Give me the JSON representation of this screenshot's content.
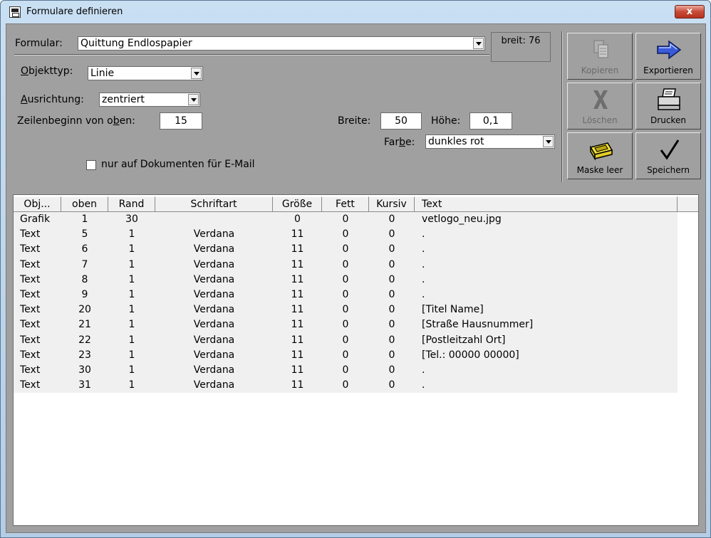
{
  "window": {
    "title": "Formulare definieren",
    "close_label": "x"
  },
  "form": {
    "formular_label": "Formular:",
    "formular_value": "Quittung Endlospapier",
    "breit_label": "breit: 76",
    "objekttyp_label": "Objekttyp:",
    "objekttyp_value": "Linie",
    "ausrichtung_label": "Ausrichtung:",
    "ausrichtung_value": "zentriert",
    "zeilenbeginn_label": "Zeilenbeginn von oben:",
    "zeilenbeginn_value": "15",
    "breite_label": "Breite:",
    "breite_value": "50",
    "hoehe_label": "Höhe:",
    "hoehe_value": "0,1",
    "farbe_label": "Farbe:",
    "farbe_value": "dunkles rot",
    "email_checkbox_label": "nur auf Dokumenten für E-Mail"
  },
  "toolbar": {
    "kopieren": "Kopieren",
    "exportieren": "Exportieren",
    "loeschen": "Löschen",
    "drucken": "Drucken",
    "maske_leer": "Maske leer",
    "speichern": "Speichern"
  },
  "table": {
    "headers": [
      "Obj...",
      "oben",
      "Rand",
      "Schriftart",
      "Größe",
      "Fett",
      "Kursiv",
      "Text"
    ],
    "rows": [
      [
        "Grafik",
        "1",
        "30",
        "",
        "0",
        "0",
        "0",
        "vetlogo_neu.jpg"
      ],
      [
        "Text",
        "5",
        "1",
        "Verdana",
        "11",
        "0",
        "0",
        "."
      ],
      [
        "Text",
        "6",
        "1",
        "Verdana",
        "11",
        "0",
        "0",
        "."
      ],
      [
        "Text",
        "7",
        "1",
        "Verdana",
        "11",
        "0",
        "0",
        "."
      ],
      [
        "Text",
        "8",
        "1",
        "Verdana",
        "11",
        "0",
        "0",
        "."
      ],
      [
        "Text",
        "9",
        "1",
        "Verdana",
        "11",
        "0",
        "0",
        "."
      ],
      [
        "Text",
        "20",
        "1",
        "Verdana",
        "11",
        "0",
        "0",
        "[Titel Name]"
      ],
      [
        "Text",
        "21",
        "1",
        "Verdana",
        "11",
        "0",
        "0",
        "[Straße Hausnummer]"
      ],
      [
        "Text",
        "22",
        "1",
        "Verdana",
        "11",
        "0",
        "0",
        "[Postleitzahl Ort]"
      ],
      [
        "Text",
        "23",
        "1",
        "Verdana",
        "11",
        "0",
        "0",
        "[Tel.: 00000 00000]"
      ],
      [
        "Text",
        "30",
        "1",
        "Verdana",
        "11",
        "0",
        "0",
        "."
      ],
      [
        "Text",
        "31",
        "1",
        "Verdana",
        "11",
        "0",
        "0",
        "."
      ]
    ]
  }
}
